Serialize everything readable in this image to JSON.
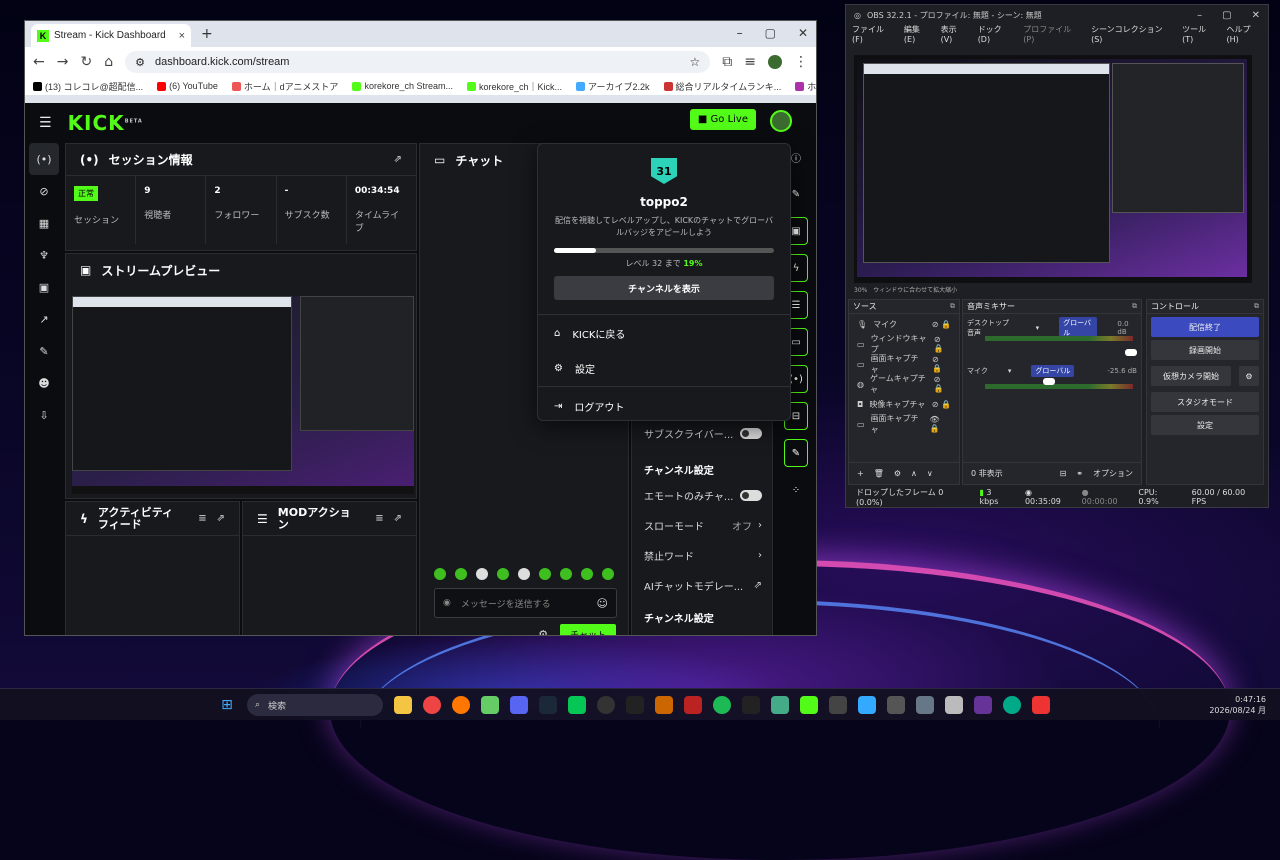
{
  "browser": {
    "tab_title": "Stream - Kick Dashboard",
    "url": "dashboard.kick.com/stream",
    "bookmarks": [
      "(13) コレコレ@超配信...",
      "(6) YouTube",
      "ホーム｜dアニメストア",
      "korekore_ch Stream...",
      "korekore_ch｜Kick...",
      "アーカイブ2.2k",
      "総合リアルタイムランキ...",
      "ホーム - DOWNTOW..."
    ]
  },
  "kick": {
    "logo": "KICK",
    "logo_beta": "BETA",
    "go_live": "Go Live",
    "session": {
      "title": "セッション情報",
      "stats": [
        {
          "value": "正常",
          "label": "セッション"
        },
        {
          "value": "9",
          "label": "視聴者"
        },
        {
          "value": "2",
          "label": "フォロワー"
        },
        {
          "value": "-",
          "label": "サブスク数"
        },
        {
          "value": "00:34:54",
          "label": "タイムライブ"
        }
      ]
    },
    "preview_title": "ストリームプレビュー",
    "activity_title": "アクティビティフィード",
    "mod_title": "MODアクション",
    "chat_title": "チャット",
    "chat_placeholder": "メッセージを送信する",
    "chat_button": "チャット",
    "right_panel": {
      "subscriber_label": "サブスクライバー...",
      "channel_settings": "チャンネル設定",
      "emote_only": "エモートのみチャ...",
      "slow_mode": "スローモード",
      "slow_mode_value": "オフ",
      "banned_words": "禁止ワード",
      "ai_moderation": "AIチャットモデレー...",
      "channel_settings_2": "チャンネル設定"
    },
    "dropdown": {
      "level_badge": "31",
      "username": "toppo2",
      "description": "配信を視聴してレベルアップし、KICKのチャットでグローバルバッジをアピールしよう",
      "progress_pct": 19,
      "level_text": "レベル 32 まで",
      "level_pct": "19%",
      "view_channel": "チャンネルを表示",
      "back_to_kick": "KICKに戻る",
      "settings": "設定",
      "logout": "ログアウト"
    }
  },
  "obs": {
    "title": "OBS 32.2.1 - プロファイル: 無題 - シーン: 無題",
    "menu": [
      "ファイル(F)",
      "編集(E)",
      "表示(V)",
      "ドック(D)",
      "プロファイル(P)",
      "シーンコレクション(S)",
      "ツール(T)",
      "ヘルプ(H)"
    ],
    "zoom_text": "30%",
    "fit_text": "ウィンドウに合わせて拡大縮小",
    "sources_title": "ソース",
    "sources": [
      "マイク",
      "ウィンドウキャプ",
      "画面キャプチャ",
      "ゲームキャプチャ",
      "映像キャプチャ",
      "画面キャプチャ"
    ],
    "mixer_title": "音声ミキサー",
    "mixer": [
      {
        "name": "デスクトップ音声",
        "mode": "グローバル",
        "db": "0.0 dB"
      },
      {
        "name": "マイク",
        "mode": "グローバル",
        "db": "-25.6 dB"
      }
    ],
    "hidden_text": "0 非表示",
    "options": "オプション",
    "controls_title": "コントロール",
    "controls": [
      "配信終了",
      "録画開始",
      "仮想カメラ開始",
      "スタジオモード",
      "設定"
    ],
    "status": {
      "dropped": "ドロップしたフレーム 0 (0.0%)",
      "kbps": "3 kbps",
      "stream_time": "00:35:09",
      "rec_time": "00:00:00",
      "cpu": "CPU: 0.9%",
      "fps": "60.00 / 60.00 FPS"
    }
  },
  "taskbar": {
    "search": "検索",
    "time": "0:47:16",
    "date": "2026/08/24 月"
  }
}
